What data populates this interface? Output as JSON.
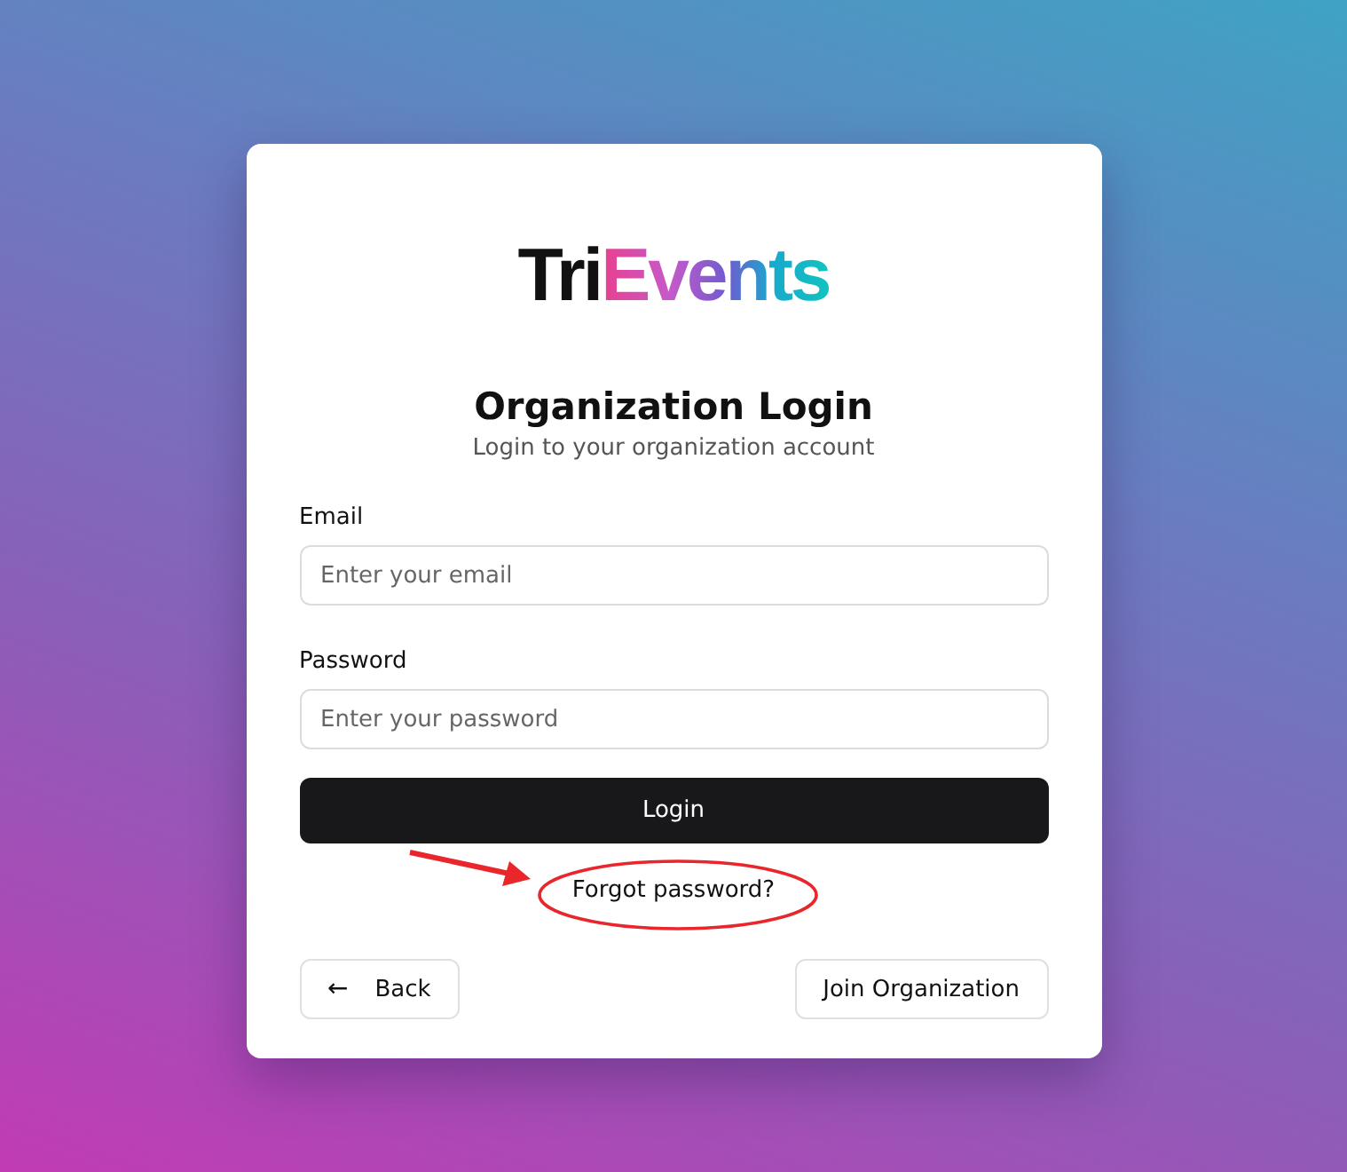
{
  "logo": [
    {
      "text": "Tri",
      "kind": "plain"
    },
    {
      "text": "Events",
      "kind": "gradient"
    }
  ],
  "title": "Organization Login",
  "subtitle": "Login to your organization account",
  "fields": [
    {
      "label": "Email",
      "placeholder": "Enter your email"
    },
    {
      "label": "Password",
      "placeholder": "Enter your password"
    }
  ],
  "login_button": "Login",
  "forgot_link": "Forgot password?",
  "back_button": {
    "icon": "←",
    "label": "Back"
  },
  "join_button": "Join Organization"
}
